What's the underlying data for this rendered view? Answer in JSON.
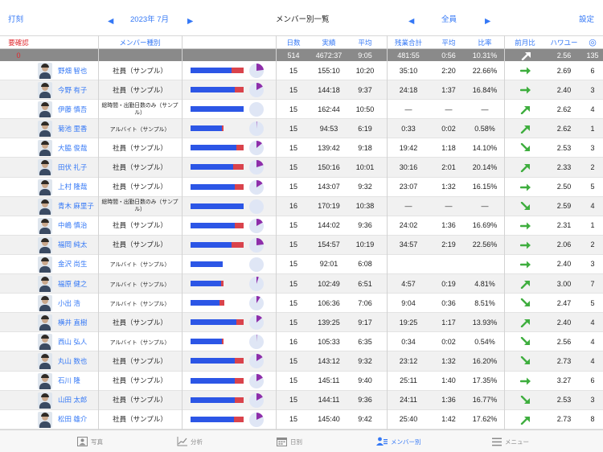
{
  "header": {
    "left_label": "打刻",
    "prev_month": "◀",
    "month": "2023年 7月",
    "next_month": "▶",
    "title": "メンバー別一覧",
    "prev_filter": "◀",
    "filter": "全員",
    "next_filter": "▶",
    "settings_label": "設定"
  },
  "columns": {
    "confirm": "要確認",
    "member_type": "メンバー種別",
    "days": "日数",
    "actual": "実績",
    "avg": "平均",
    "ot_total": "残業合計",
    "ot_avg": "平均",
    "ratio": "比率",
    "mom": "前月比",
    "power": "ハワユー",
    "icon": "◎"
  },
  "totals": {
    "confirm": "0",
    "days": "514",
    "actual": "4672:37",
    "avg": "9:05",
    "ot_total": "481:55",
    "ot_avg": "0:56",
    "ratio": "10.31%",
    "trend": "up-right-white",
    "power": "2.56",
    "count": "135"
  },
  "rows": [
    {
      "name": "野畑 智也",
      "type": "社員（サンプル）",
      "type_size": "normal",
      "days": "15",
      "actual": "155:10",
      "avg": "10:20",
      "ot_total": "35:10",
      "ot_avg": "2:20",
      "ratio": "22.66%",
      "trend": "right",
      "power": "2.69",
      "count": "6",
      "regular_fraction": 0.77,
      "overtime_fraction": 0.23
    },
    {
      "name": "今野 有子",
      "type": "社員（サンプル）",
      "type_size": "normal",
      "days": "15",
      "actual": "144:18",
      "avg": "9:37",
      "ot_total": "24:18",
      "ot_avg": "1:37",
      "ratio": "16.84%",
      "trend": "right",
      "power": "2.40",
      "count": "3",
      "regular_fraction": 0.83,
      "overtime_fraction": 0.17
    },
    {
      "name": "伊藤 慎吾",
      "type": "総時間・出勤日数のみ（サンプル）",
      "type_size": "wrap",
      "days": "15",
      "actual": "162:44",
      "avg": "10:50",
      "ot_total": "―",
      "ot_avg": "―",
      "ratio": "―",
      "trend": "up",
      "power": "2.62",
      "count": "4",
      "regular_fraction": 1.0,
      "overtime_fraction": 0
    },
    {
      "name": "菊池 里香",
      "type": "アルバイト（サンプル）",
      "type_size": "small",
      "days": "15",
      "actual": "94:53",
      "avg": "6:19",
      "ot_total": "0:33",
      "ot_avg": "0:02",
      "ratio": "0.58%",
      "trend": "up",
      "power": "2.62",
      "count": "1",
      "regular_fraction": 0.99,
      "overtime_fraction": 0.01
    },
    {
      "name": "大脇 俊哉",
      "type": "社員（サンプル）",
      "type_size": "normal",
      "days": "15",
      "actual": "139:42",
      "avg": "9:18",
      "ot_total": "19:42",
      "ot_avg": "1:18",
      "ratio": "14.10%",
      "trend": "down",
      "power": "2.53",
      "count": "3",
      "regular_fraction": 0.86,
      "overtime_fraction": 0.14
    },
    {
      "name": "田伏 礼子",
      "type": "社員（サンプル）",
      "type_size": "normal",
      "days": "15",
      "actual": "150:16",
      "avg": "10:01",
      "ot_total": "30:16",
      "ot_avg": "2:01",
      "ratio": "20.14%",
      "trend": "up",
      "power": "2.33",
      "count": "2",
      "regular_fraction": 0.8,
      "overtime_fraction": 0.2
    },
    {
      "name": "上村 隆哉",
      "type": "社員（サンプル）",
      "type_size": "normal",
      "days": "15",
      "actual": "143:07",
      "avg": "9:32",
      "ot_total": "23:07",
      "ot_avg": "1:32",
      "ratio": "16.15%",
      "trend": "right",
      "power": "2.50",
      "count": "5",
      "regular_fraction": 0.84,
      "overtime_fraction": 0.16
    },
    {
      "name": "青木 麻里子",
      "type": "総時間・出勤日数のみ（サンプル）",
      "type_size": "wrap",
      "days": "16",
      "actual": "170:19",
      "avg": "10:38",
      "ot_total": "―",
      "ot_avg": "―",
      "ratio": "―",
      "trend": "down",
      "power": "2.59",
      "count": "4",
      "regular_fraction": 1.0,
      "overtime_fraction": 0
    },
    {
      "name": "中嶋 慎治",
      "type": "社員（サンプル）",
      "type_size": "normal",
      "days": "15",
      "actual": "144:02",
      "avg": "9:36",
      "ot_total": "24:02",
      "ot_avg": "1:36",
      "ratio": "16.69%",
      "trend": "right",
      "power": "2.31",
      "count": "1",
      "regular_fraction": 0.83,
      "overtime_fraction": 0.17
    },
    {
      "name": "福岡 純太",
      "type": "社員（サンプル）",
      "type_size": "normal",
      "days": "15",
      "actual": "154:57",
      "avg": "10:19",
      "ot_total": "34:57",
      "ot_avg": "2:19",
      "ratio": "22.56%",
      "trend": "right",
      "power": "2.06",
      "count": "2",
      "regular_fraction": 0.77,
      "overtime_fraction": 0.23
    },
    {
      "name": "金沢 尚生",
      "type": "アルバイト（サンプル）",
      "type_size": "small",
      "days": "15",
      "actual": "92:01",
      "avg": "6:08",
      "ot_total": "",
      "ot_avg": "",
      "ratio": "",
      "trend": "right",
      "power": "2.40",
      "count": "3",
      "regular_fraction": 1.0,
      "overtime_fraction": 0
    },
    {
      "name": "福原 健之",
      "type": "アルバイト（サンプル）",
      "type_size": "small",
      "days": "15",
      "actual": "102:49",
      "avg": "6:51",
      "ot_total": "4:57",
      "ot_avg": "0:19",
      "ratio": "4.81%",
      "trend": "up",
      "power": "3.00",
      "count": "7",
      "regular_fraction": 0.95,
      "overtime_fraction": 0.05
    },
    {
      "name": "小出 浩",
      "type": "アルバイト（サンプル）",
      "type_size": "small",
      "days": "15",
      "actual": "106:36",
      "avg": "7:06",
      "ot_total": "9:04",
      "ot_avg": "0:36",
      "ratio": "8.51%",
      "trend": "down",
      "power": "2.47",
      "count": "5",
      "regular_fraction": 0.91,
      "overtime_fraction": 0.09
    },
    {
      "name": "横井 直樹",
      "type": "社員（サンプル）",
      "type_size": "normal",
      "days": "15",
      "actual": "139:25",
      "avg": "9:17",
      "ot_total": "19:25",
      "ot_avg": "1:17",
      "ratio": "13.93%",
      "trend": "up",
      "power": "2.40",
      "count": "4",
      "regular_fraction": 0.86,
      "overtime_fraction": 0.14
    },
    {
      "name": "西山 弘人",
      "type": "アルバイト（サンプル）",
      "type_size": "small",
      "days": "16",
      "actual": "105:33",
      "avg": "6:35",
      "ot_total": "0:34",
      "ot_avg": "0:02",
      "ratio": "0.54%",
      "trend": "down",
      "power": "2.56",
      "count": "4",
      "regular_fraction": 0.99,
      "overtime_fraction": 0.01
    },
    {
      "name": "丸山 数也",
      "type": "社員（サンプル）",
      "type_size": "normal",
      "days": "15",
      "actual": "143:12",
      "avg": "9:32",
      "ot_total": "23:12",
      "ot_avg": "1:32",
      "ratio": "16.20%",
      "trend": "down",
      "power": "2.73",
      "count": "4",
      "regular_fraction": 0.84,
      "overtime_fraction": 0.16
    },
    {
      "name": "石川 隆",
      "type": "社員（サンプル）",
      "type_size": "normal",
      "days": "15",
      "actual": "145:11",
      "avg": "9:40",
      "ot_total": "25:11",
      "ot_avg": "1:40",
      "ratio": "17.35%",
      "trend": "right",
      "power": "3.27",
      "count": "6",
      "regular_fraction": 0.83,
      "overtime_fraction": 0.17
    },
    {
      "name": "山田 太郎",
      "type": "社員（サンプル）",
      "type_size": "normal",
      "days": "15",
      "actual": "144:11",
      "avg": "9:36",
      "ot_total": "24:11",
      "ot_avg": "1:36",
      "ratio": "16.77%",
      "trend": "down",
      "power": "2.53",
      "count": "3",
      "regular_fraction": 0.83,
      "overtime_fraction": 0.17
    },
    {
      "name": "松田 雄介",
      "type": "社員（サンプル）",
      "type_size": "normal",
      "days": "15",
      "actual": "145:40",
      "avg": "9:42",
      "ot_total": "25:40",
      "ot_avg": "1:42",
      "ratio": "17.62%",
      "trend": "up",
      "power": "2.73",
      "count": "8",
      "regular_fraction": 0.82,
      "overtime_fraction": 0.18
    }
  ],
  "tabs": [
    {
      "label": "写真",
      "icon": "photo-icon",
      "active": false
    },
    {
      "label": "分析",
      "icon": "chart-icon",
      "active": false
    },
    {
      "label": "日別",
      "icon": "calendar-icon",
      "active": false
    },
    {
      "label": "メンバー別",
      "icon": "members-icon",
      "active": true
    },
    {
      "label": "メニュー",
      "icon": "menu-icon",
      "active": false
    }
  ],
  "colors": {
    "accent": "#3478f6",
    "regular_bar": "#2c56e6",
    "overtime_bar": "#d9434c",
    "pie": "#8e2eaa",
    "trend_arrow": "#3fae3f",
    "alert": "#e0282e"
  }
}
